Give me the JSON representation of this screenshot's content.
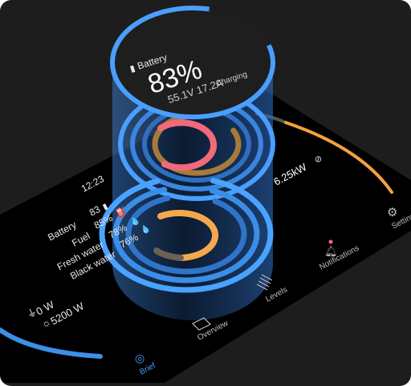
{
  "colors": {
    "background": "#1d1d1d",
    "panel": "#000000",
    "accent_blue": "#4a9eff",
    "orange": "#f5a040",
    "pink": "#f06a7a",
    "text": "#e8e8e8"
  },
  "battery_card": {
    "icon": "battery-icon",
    "label": "Battery",
    "percent": "83%",
    "voltage_current": "55.1V 17.2A",
    "status": "Charging"
  },
  "clock": "12:23",
  "levels": [
    {
      "label": "Battery",
      "value": "83",
      "icon": "battery-icon"
    },
    {
      "label": "Fuel",
      "value": "85%",
      "icon": "fuel-icon"
    },
    {
      "label": "Fresh water",
      "value": "78%",
      "icon": "water-drop-icon"
    },
    {
      "label": "Black water",
      "value": "76%",
      "icon": "waste-drop-icon"
    }
  ],
  "power": {
    "shore": "0 W",
    "solar": "5200 W",
    "load": "6.25kW",
    "load_icon": "gauge-icon"
  },
  "nav": [
    {
      "label": "Brief",
      "icon": "brief-icon",
      "active": true
    },
    {
      "label": "Overview",
      "icon": "overview-icon",
      "active": false
    },
    {
      "label": "Levels",
      "icon": "levels-icon",
      "active": false
    },
    {
      "label": "Notifications",
      "icon": "bell-icon",
      "active": false
    },
    {
      "label": "Settings",
      "icon": "gear-icon",
      "active": false
    }
  ]
}
